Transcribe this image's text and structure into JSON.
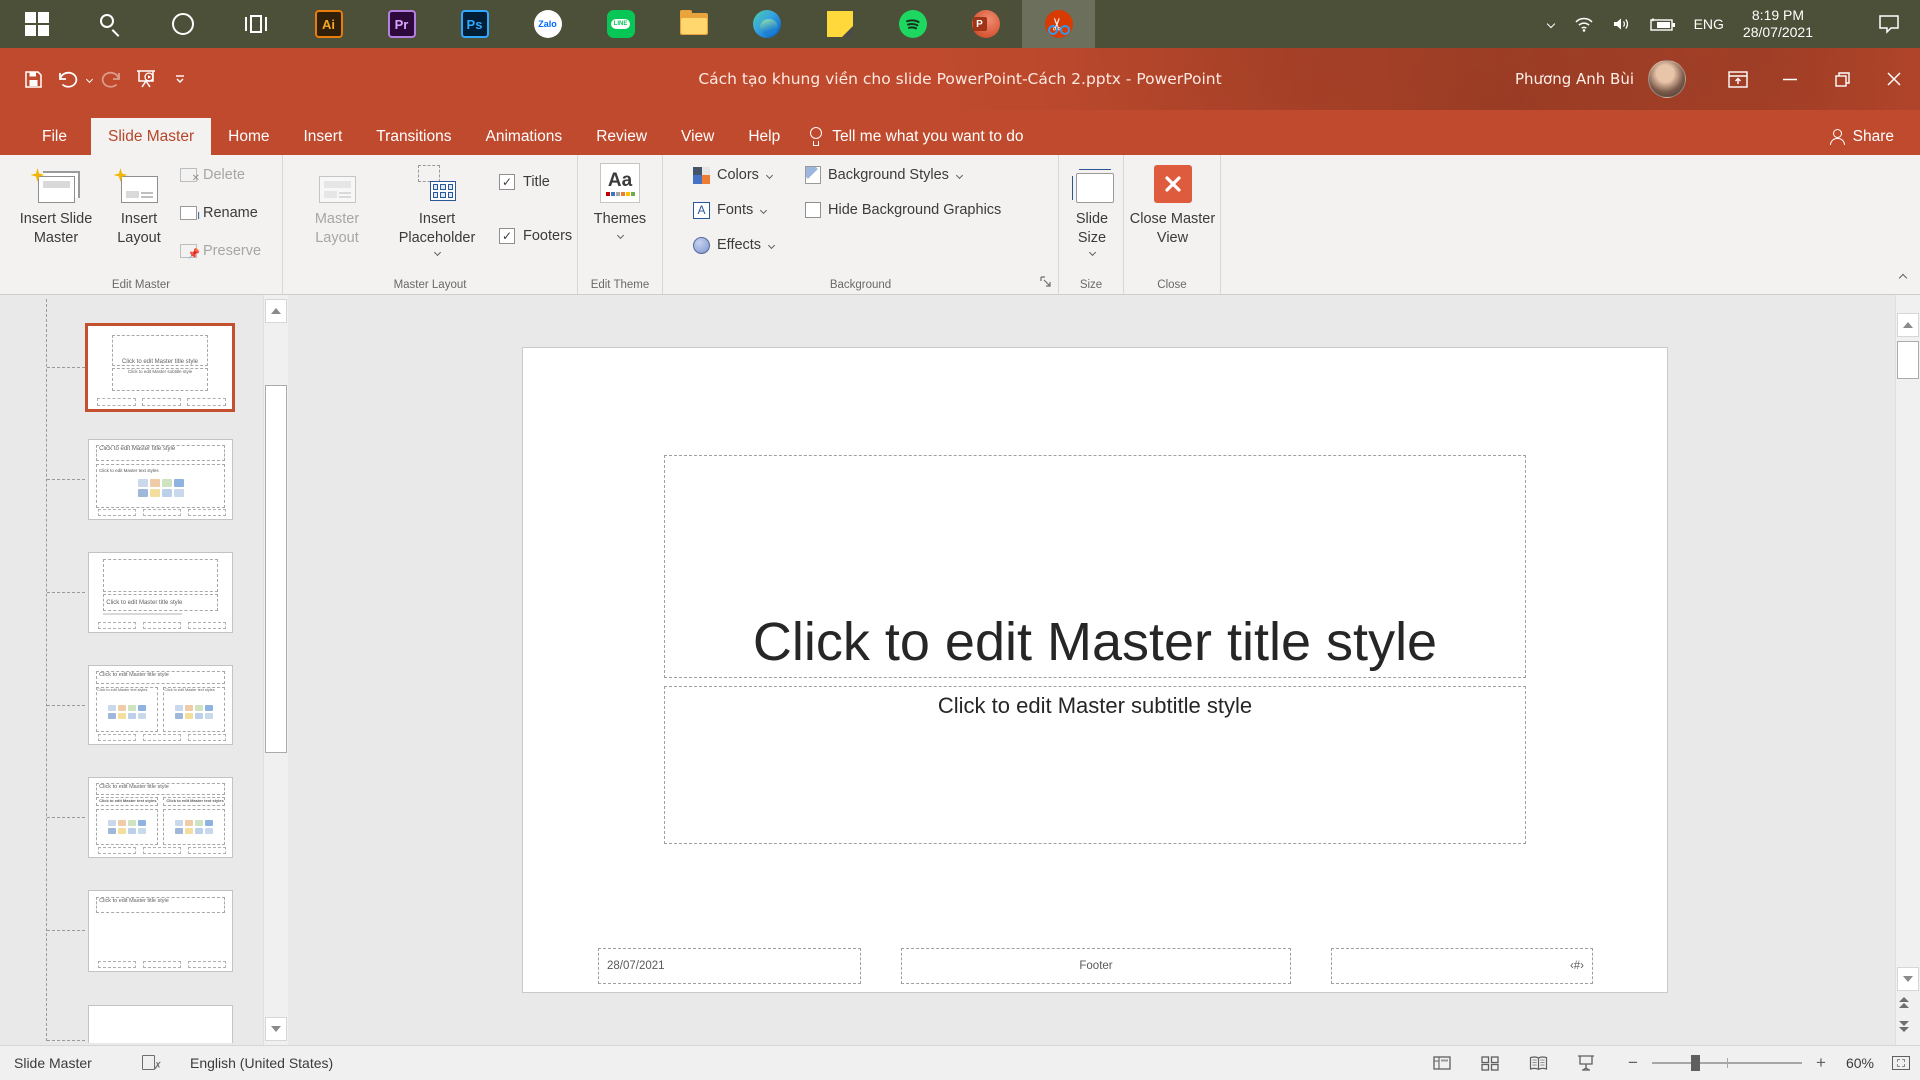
{
  "taskbar": {
    "badges": {
      "illustrator": "Ai",
      "premiere": "Pr",
      "photoshop": "Ps",
      "zalo": "Zalo",
      "line": "LINE",
      "powerpoint": "P",
      "snipping": "✂"
    },
    "tray": {
      "language": "ENG",
      "time": "8:19 PM",
      "date": "28/07/2021"
    }
  },
  "titlebar": {
    "title": "Cách tạo khung viền cho slide PowerPoint-Cách 2.pptx  -  PowerPoint",
    "user": "Phương Anh Bùi"
  },
  "ribbon": {
    "tabs": [
      {
        "label": "File"
      },
      {
        "label": "Slide Master"
      },
      {
        "label": "Home"
      },
      {
        "label": "Insert"
      },
      {
        "label": "Transitions"
      },
      {
        "label": "Animations"
      },
      {
        "label": "Review"
      },
      {
        "label": "View"
      },
      {
        "label": "Help"
      }
    ],
    "tell_me": "Tell me what you want to do",
    "share": "Share",
    "groups": {
      "edit_master": {
        "label": "Edit Master",
        "insert_slide_master": "Insert Slide Master",
        "insert_layout": "Insert Layout",
        "delete": "Delete",
        "rename": "Rename",
        "preserve": "Preserve"
      },
      "master_layout": {
        "label": "Master Layout",
        "master_layout": "Master Layout",
        "insert_placeholder": "Insert Placeholder",
        "title_checkbox": "Title",
        "footers_checkbox": "Footers"
      },
      "edit_theme": {
        "label": "Edit Theme",
        "themes": "Themes"
      },
      "background": {
        "label": "Background",
        "colors": "Colors",
        "fonts": "Fonts",
        "effects": "Effects",
        "background_styles": "Background Styles",
        "hide_background_graphics": "Hide Background Graphics"
      },
      "size": {
        "label": "Size",
        "slide_size": "Slide Size"
      },
      "close": {
        "label": "Close",
        "close_master_view": "Close Master View"
      }
    }
  },
  "thumbnails": {
    "title_text": "Click to edit Master title style",
    "subtitle_text": "Click to edit Master subtitle style",
    "body_text": "Click to edit Master text styles"
  },
  "slide": {
    "title_placeholder": "Click to edit Master title style",
    "subtitle_placeholder": "Click to edit Master subtitle style",
    "date": "28/07/2021",
    "footer": "Footer",
    "slide_number": "‹#›"
  },
  "statusbar": {
    "view": "Slide Master",
    "language": "English (United States)",
    "zoom_level": "60%"
  },
  "colors": {
    "titlebar_red": "#bf4a2d",
    "accent_red": "#b7472a",
    "taskbar_olive": "#4c5038",
    "close_master_x": "#df5b3e",
    "selected_thumb_border": "#c4502e"
  }
}
